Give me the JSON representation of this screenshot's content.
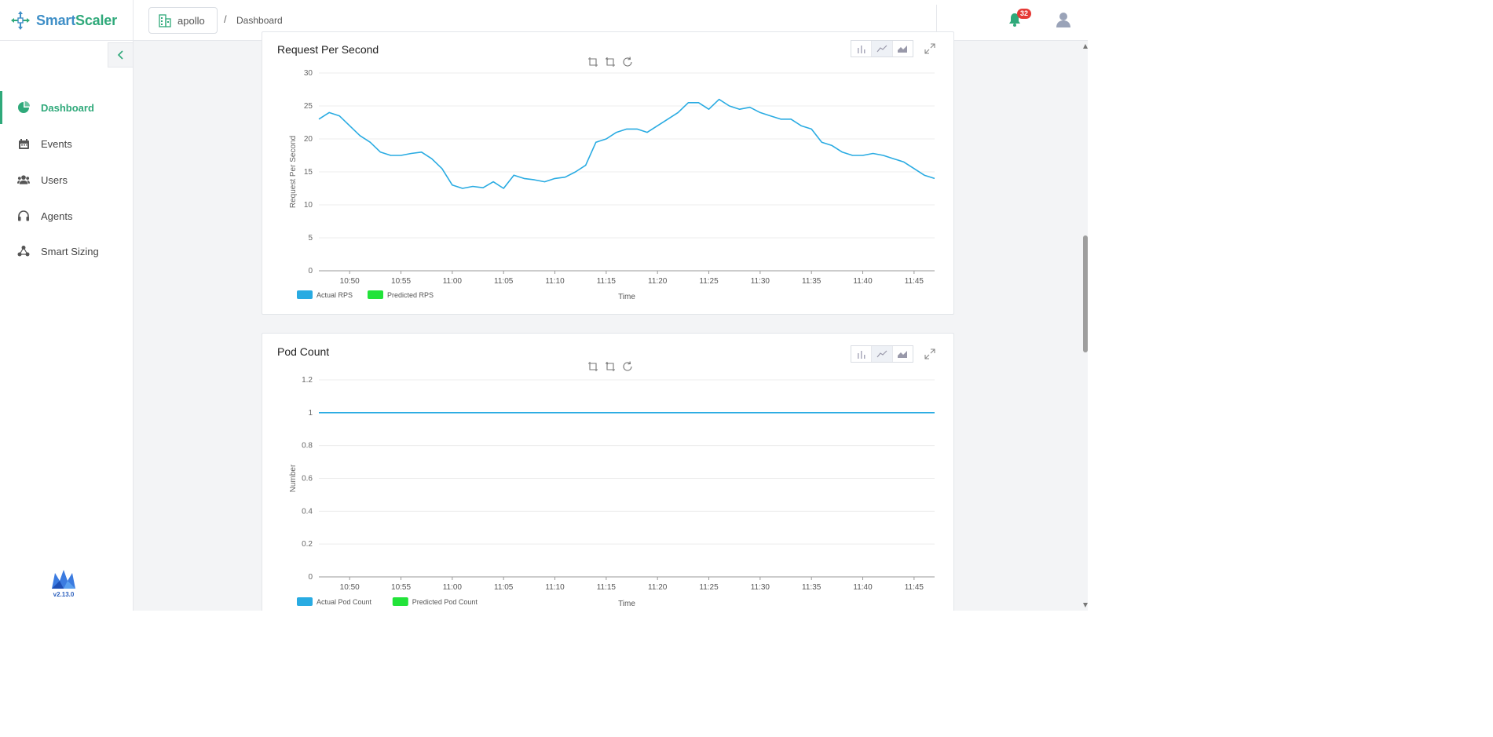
{
  "app": {
    "brand_part1": "Smart",
    "brand_part2": "Scaler",
    "version": "v2.13.0"
  },
  "header": {
    "cluster_name": "apollo",
    "breadcrumb_separator": "/",
    "breadcrumb_page": "Dashboard",
    "notification_count": "32"
  },
  "sidebar": {
    "items": [
      {
        "label": "Dashboard",
        "icon": "pie-chart-icon",
        "active": true
      },
      {
        "label": "Events",
        "icon": "calendar-icon",
        "active": false
      },
      {
        "label": "Users",
        "icon": "users-icon",
        "active": false
      },
      {
        "label": "Agents",
        "icon": "headset-icon",
        "active": false
      },
      {
        "label": "Smart Sizing",
        "icon": "cluster-icon",
        "active": false
      }
    ]
  },
  "colors": {
    "accent": "#2fa97a",
    "actual_series": "#29abe2",
    "predicted_series": "#22e33a",
    "badge": "#e53935"
  },
  "chart_data": [
    {
      "type": "line",
      "title": "Request Per Second",
      "xlabel": "Time",
      "ylabel": "Request Per Second",
      "ylim": [
        0,
        30
      ],
      "yticks": [
        "0",
        "5",
        "10",
        "15",
        "20",
        "25",
        "30"
      ],
      "xticks": [
        "10:50",
        "10:55",
        "11:00",
        "11:05",
        "11:10",
        "11:15",
        "11:20",
        "11:25",
        "11:30",
        "11:35",
        "11:40",
        "11:45"
      ],
      "xlim": [
        "10:47",
        "11:47"
      ],
      "grid": true,
      "legend_position": "bottom-left",
      "series": [
        {
          "name": "Actual RPS",
          "x": [
            "10:47",
            "10:48",
            "10:49",
            "10:50",
            "10:51",
            "10:52",
            "10:53",
            "10:54",
            "10:55",
            "10:56",
            "10:57",
            "10:58",
            "10:59",
            "11:00",
            "11:01",
            "11:02",
            "11:03",
            "11:04",
            "11:05",
            "11:06",
            "11:07",
            "11:08",
            "11:09",
            "11:10",
            "11:11",
            "11:12",
            "11:13",
            "11:14",
            "11:15",
            "11:16",
            "11:17",
            "11:18",
            "11:19",
            "11:20",
            "11:21",
            "11:22",
            "11:23",
            "11:24",
            "11:25",
            "11:26",
            "11:27",
            "11:28",
            "11:29",
            "11:30",
            "11:31",
            "11:32",
            "11:33",
            "11:34",
            "11:35",
            "11:36",
            "11:37",
            "11:38",
            "11:39",
            "11:40",
            "11:41",
            "11:42",
            "11:43",
            "11:44",
            "11:45",
            "11:46",
            "11:47"
          ],
          "values": [
            23.0,
            24.0,
            23.5,
            22.0,
            20.5,
            19.5,
            18.0,
            17.5,
            17.5,
            17.8,
            18.0,
            17.0,
            15.5,
            13.0,
            12.5,
            12.8,
            12.6,
            13.5,
            12.5,
            14.5,
            14.0,
            13.8,
            13.5,
            14.0,
            14.2,
            15.0,
            16.0,
            19.5,
            20.0,
            21.0,
            21.5,
            21.5,
            21.0,
            22.0,
            23.0,
            24.0,
            25.5,
            25.5,
            24.5,
            26.0,
            25.0,
            24.5,
            24.8,
            24.0,
            23.5,
            23.0,
            23.0,
            22.0,
            21.5,
            19.5,
            19.0,
            18.0,
            17.5,
            17.5,
            17.8,
            17.5,
            17.0,
            16.5,
            15.5,
            14.5,
            14.0
          ]
        },
        {
          "name": "Predicted RPS",
          "x": [],
          "values": []
        }
      ]
    },
    {
      "type": "line",
      "title": "Pod Count",
      "xlabel": "Time",
      "ylabel": "Number",
      "ylim": [
        0,
        1.2
      ],
      "yticks": [
        "0",
        "0.2",
        "0.4",
        "0.6",
        "0.8",
        "1",
        "1.2"
      ],
      "xticks": [
        "10:50",
        "10:55",
        "11:00",
        "11:05",
        "11:10",
        "11:15",
        "11:20",
        "11:25",
        "11:30",
        "11:35",
        "11:40",
        "11:45"
      ],
      "xlim": [
        "10:47",
        "11:47"
      ],
      "grid": true,
      "legend_position": "bottom-left",
      "series": [
        {
          "name": "Actual Pod Count",
          "x": [
            "10:47",
            "11:47"
          ],
          "values": [
            1,
            1
          ]
        },
        {
          "name": "Predicted Pod Count",
          "x": [],
          "values": []
        }
      ]
    }
  ]
}
